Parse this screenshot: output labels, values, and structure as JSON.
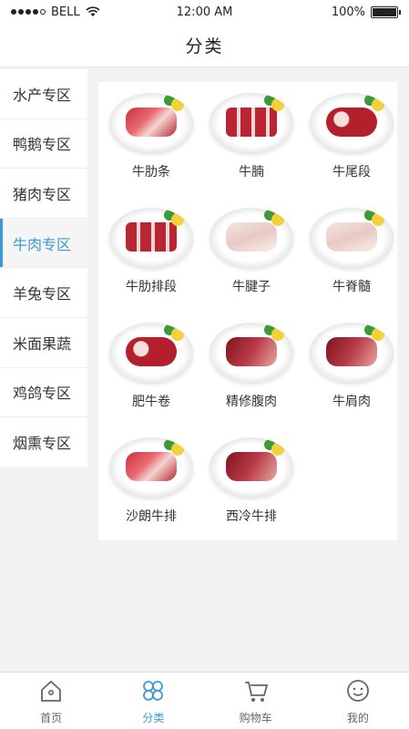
{
  "status": {
    "carrier": "BELL",
    "time": "12:00 AM",
    "battery": "100%"
  },
  "nav": {
    "title": "分类"
  },
  "sidebar": {
    "items": [
      {
        "label": "水产专区"
      },
      {
        "label": "鸭鹅专区"
      },
      {
        "label": "猪肉专区"
      },
      {
        "label": "牛肉专区"
      },
      {
        "label": "羊兔专区"
      },
      {
        "label": "米面果蔬"
      },
      {
        "label": "鸡鸽专区"
      },
      {
        "label": "烟熏专区"
      }
    ],
    "active_index": 3,
    "active_color": "#3a9ad9"
  },
  "products": [
    {
      "label": "牛肋条"
    },
    {
      "label": "牛腩"
    },
    {
      "label": "牛尾段"
    },
    {
      "label": "牛肋排段"
    },
    {
      "label": "牛腱子"
    },
    {
      "label": "牛脊髓"
    },
    {
      "label": "肥牛卷"
    },
    {
      "label": "精修腹肉"
    },
    {
      "label": "牛肩肉"
    },
    {
      "label": "沙朗牛排"
    },
    {
      "label": "西冷牛排"
    }
  ],
  "tabs": [
    {
      "label": "首页",
      "icon": "home-icon"
    },
    {
      "label": "分类",
      "icon": "category-icon"
    },
    {
      "label": "购物车",
      "icon": "cart-icon"
    },
    {
      "label": "我的",
      "icon": "profile-icon"
    }
  ],
  "active_tab": 1
}
